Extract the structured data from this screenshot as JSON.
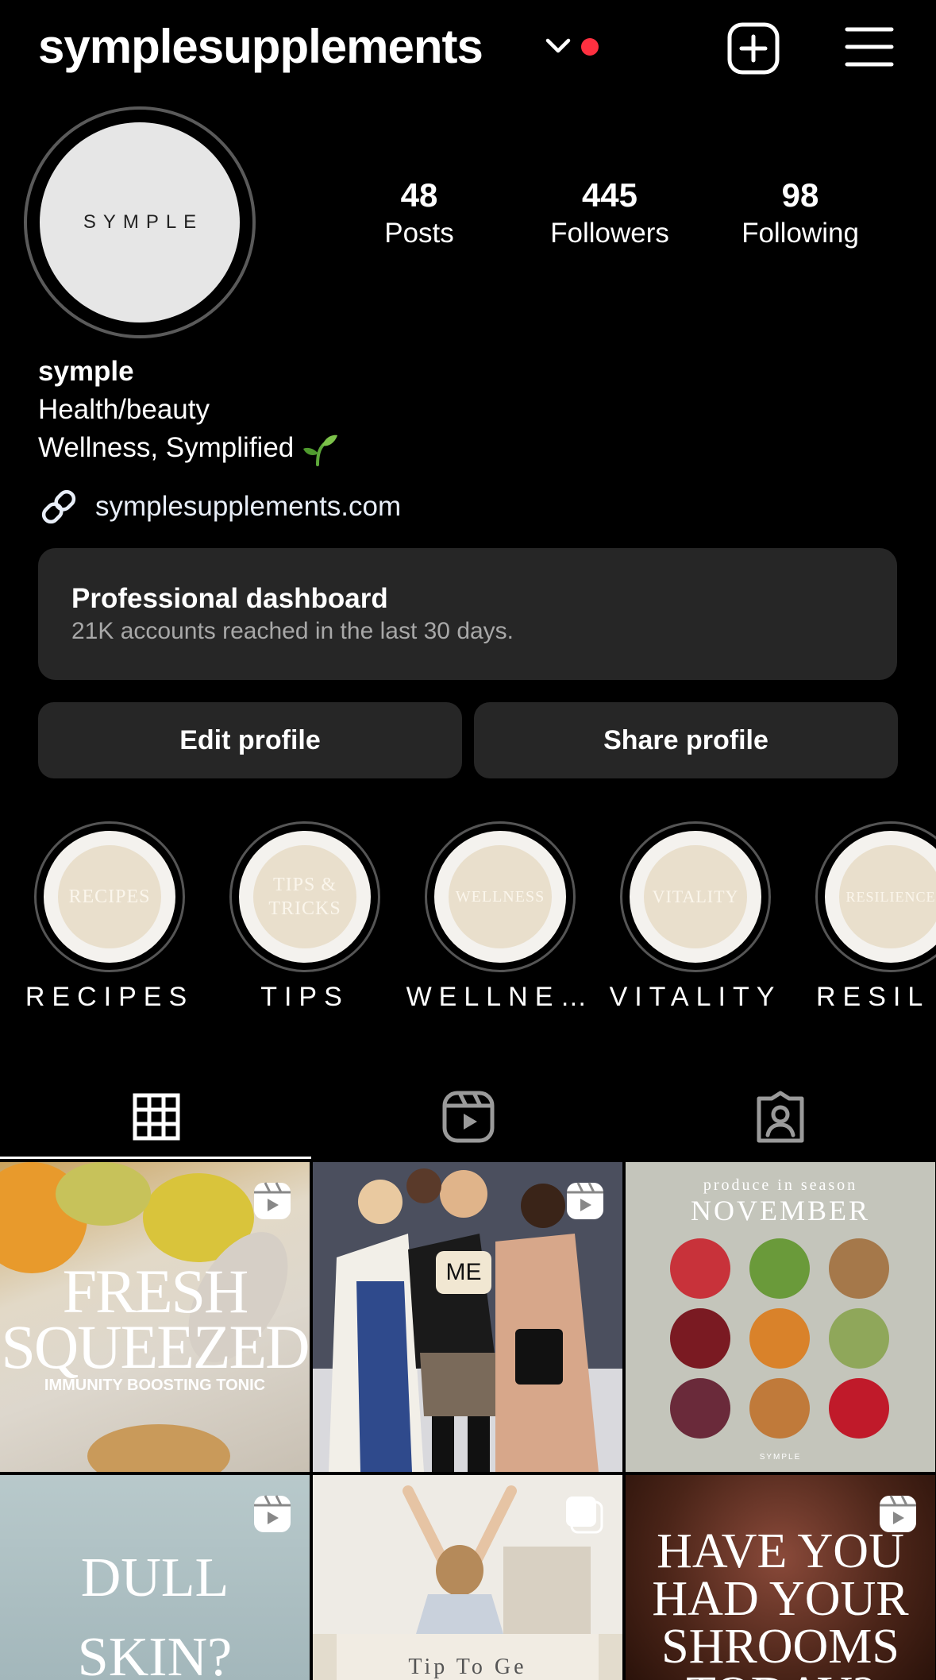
{
  "header": {
    "username": "symplesupplements",
    "has_notification": true,
    "icons": [
      "chevron-down-icon",
      "plus-square-icon",
      "hamburger-menu-icon"
    ]
  },
  "profile": {
    "avatar_text": "SYMPLE",
    "stats": [
      {
        "value": "48",
        "label": "Posts"
      },
      {
        "value": "445",
        "label": "Followers"
      },
      {
        "value": "98",
        "label": "Following"
      }
    ],
    "name": "symple",
    "category": "Health/beauty",
    "bio": "Wellness, Symplified",
    "bio_emoji": "seedling",
    "link": "symplesupplements.com"
  },
  "dashboard": {
    "title": "Professional dashboard",
    "subtitle": "21K accounts reached in the last 30 days."
  },
  "actions": {
    "edit": "Edit profile",
    "share": "Share profile"
  },
  "highlights": [
    {
      "label": "RECIPES",
      "cover_text": "RECIPES"
    },
    {
      "label": "TIPS",
      "cover_text": "TIPS & TRICKS"
    },
    {
      "label": "WELLNE…",
      "cover_text": "WELLNESS"
    },
    {
      "label": "VITALITY",
      "cover_text": "VITALITY"
    },
    {
      "label": "RESIL",
      "cover_text": "RESILIENCE"
    }
  ],
  "tabs": [
    "grid-icon",
    "reels-icon",
    "tagged-icon"
  ],
  "active_tab": 0,
  "posts": [
    {
      "type": "reel",
      "title": "FRESH SQUEEZED",
      "subtitle": "IMMUNITY BOOSTING TONIC"
    },
    {
      "type": "reel",
      "caption": "ME"
    },
    {
      "type": "image",
      "kicker": "produce in season",
      "title": "NOVEMBER",
      "brand": "SYMPLE"
    },
    {
      "type": "reel",
      "title": "DULL SKIN?"
    },
    {
      "type": "carousel",
      "title": "Tip To Ge"
    },
    {
      "type": "reel",
      "title": "HAVE YOU HAD YOUR SHROOMS TODAY?"
    }
  ],
  "colors": {
    "background": "#000000",
    "surface": "#262626",
    "notification": "#ff3040",
    "highlight_cover": "#e9dfcc"
  }
}
